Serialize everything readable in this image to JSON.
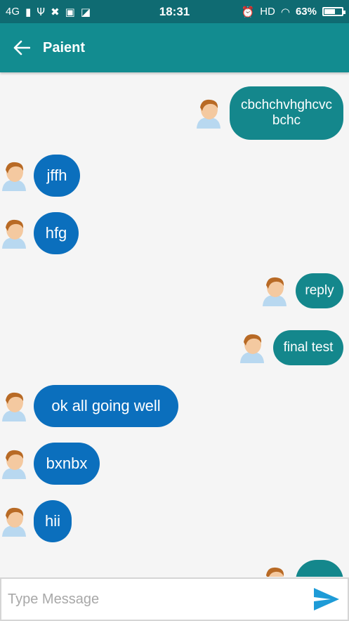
{
  "status_bar": {
    "network": "4G",
    "time": "18:31",
    "hd": "HD",
    "battery": "63%",
    "battery_level": 0.63
  },
  "header": {
    "title": "Paient"
  },
  "messages": [
    {
      "side": "right",
      "text": "cbchchvhghcvc bchc"
    },
    {
      "side": "left",
      "text": "jffh"
    },
    {
      "side": "left",
      "text": "hfg"
    },
    {
      "side": "right",
      "text": "reply"
    },
    {
      "side": "right",
      "text": "final test"
    },
    {
      "side": "left",
      "text": "ok all going well"
    },
    {
      "side": "left",
      "text": "bxnbx"
    },
    {
      "side": "left",
      "text": "hii"
    },
    {
      "side": "right",
      "text": ""
    }
  ],
  "composer": {
    "placeholder": "Type Message"
  },
  "colors": {
    "status_bar": "#0f6b72",
    "app_bar": "#128c90",
    "incoming_bubble": "#0b6fbd",
    "outgoing_bubble": "#14878c",
    "send_icon": "#1e9bd7"
  }
}
